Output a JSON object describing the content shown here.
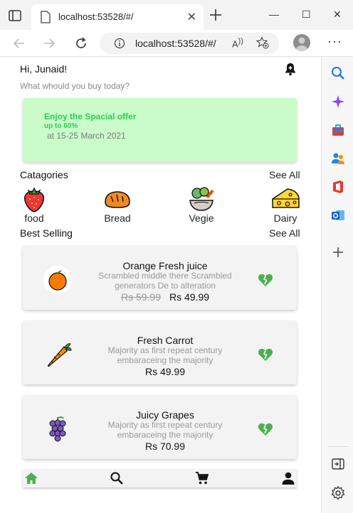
{
  "browser": {
    "tab_title": "localhost:53528/#/",
    "url": "localhost:53528/#/"
  },
  "app": {
    "greeting": "Hi, Junaid!",
    "subtitle": "What whould you buy today?",
    "offer": {
      "title": "Enjoy the Spacial offer",
      "discount": "up to 60%",
      "dates": "at 15-25 March 2021"
    },
    "categories_title": "Catagories",
    "see_all": "See All",
    "categories": [
      {
        "label": "food",
        "icon": "strawberry-icon"
      },
      {
        "label": "Bread",
        "icon": "bread-icon"
      },
      {
        "label": "Vegie",
        "icon": "vegetables-icon"
      },
      {
        "label": "Dairy",
        "icon": "cheese-icon"
      }
    ],
    "best_selling_title": "Best Selling",
    "products": [
      {
        "name": "Orange Fresh juice",
        "desc": "Scrambled middle there Scrambled generators De to alteration",
        "old_price": "Rs 59.99",
        "price": "Rs 49.99",
        "icon": "orange-icon"
      },
      {
        "name": "Fresh Carrot",
        "desc": "Majority as first repeat century embaraceing the majority",
        "price": "Rs 49.99",
        "icon": "carrot-icon"
      },
      {
        "name": "Juicy Grapes",
        "desc": "Majority as first repeat century embaraceing the majority",
        "price": "Rs 70.99",
        "icon": "grapes-icon"
      }
    ],
    "bottom_nav": [
      "home-icon",
      "search-icon",
      "cart-icon",
      "person-icon"
    ],
    "colors": {
      "accent": "#4caf50",
      "offer_bg": "#c9fcc9",
      "offer_text": "#2ecc5a"
    }
  }
}
